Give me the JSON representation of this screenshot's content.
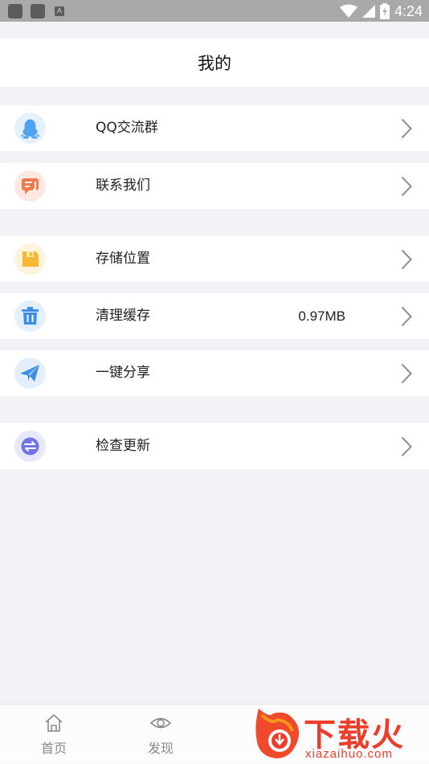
{
  "status_bar": {
    "time": "4:24",
    "icons": [
      "app-notification-icon",
      "app-notification-icon",
      "accessibility-a-icon",
      "wifi-icon",
      "signal-icon",
      "battery-charging-icon"
    ]
  },
  "header": {
    "title": "我的"
  },
  "menu": [
    {
      "id": "qq-group",
      "label": "QQ交流群",
      "icon": "qq-penguin-icon",
      "icon_bg": "#e6f1fb",
      "icon_color": "#4fa3f0"
    },
    {
      "id": "contact-us",
      "label": "联系我们",
      "icon": "chat-bubble-icon",
      "icon_bg": "#fde9e2",
      "icon_color": "#f07a4a"
    },
    {
      "id": "storage-location",
      "label": "存储位置",
      "icon": "folder-save-icon",
      "icon_bg": "#fdf3dc",
      "icon_color": "#f7b733"
    },
    {
      "id": "clear-cache",
      "label": "清理缓存",
      "value": "0.97MB",
      "icon": "trash-icon",
      "icon_bg": "#e3f0fb",
      "icon_color": "#3d8ee8"
    },
    {
      "id": "share",
      "label": "一键分享",
      "icon": "paper-plane-icon",
      "icon_bg": "#e3f0fb",
      "icon_color": "#3d8ee8"
    },
    {
      "id": "check-update",
      "label": "检查更新",
      "icon": "refresh-arrows-icon",
      "icon_bg": "#e7e8fb",
      "icon_color": "#6f74e6"
    }
  ],
  "bottom_nav": [
    {
      "label": "首页",
      "icon": "home-icon"
    },
    {
      "label": "发现",
      "icon": "eye-icon"
    }
  ],
  "watermark": {
    "text": "下载火",
    "url": "xiazaihuo.com",
    "color": "#ec3c2a"
  }
}
